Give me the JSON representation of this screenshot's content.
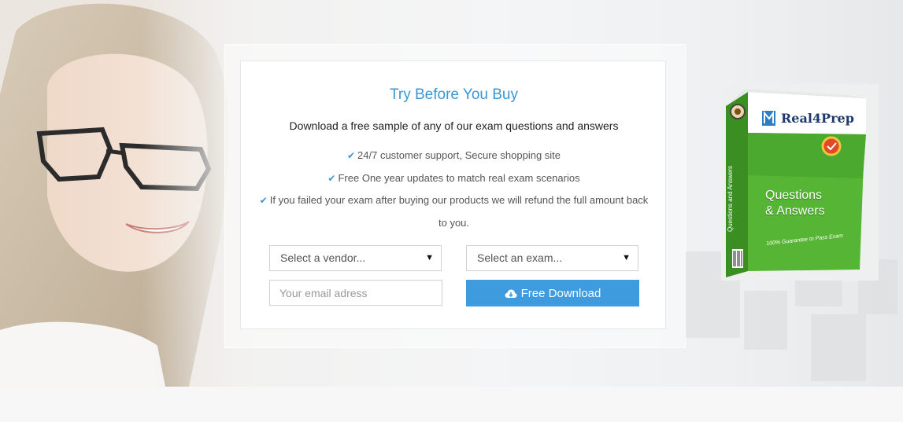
{
  "trial": {
    "title": "Try Before You Buy",
    "subtitle": "Download a free sample of any of our exam questions and answers",
    "features": [
      "24/7 customer support, Secure shopping site",
      "Free One year updates to match real exam scenarios",
      "If you failed your exam after buying our products we will refund the full amount back to you."
    ]
  },
  "form": {
    "vendor_select": "Select a vendor...",
    "exam_select": "Select an exam...",
    "email_placeholder": "Your email adress",
    "download_label": "Free Download"
  },
  "product_box": {
    "brand": "Real4Prep",
    "line1": "Questions",
    "line2": "& Answers",
    "guarantee": "100% Guarantee to Pass Exam",
    "side_text": "Questions and Answers"
  },
  "icons": {
    "feature_check": "check-icon",
    "download_cloud": "cloud-download-icon",
    "select_arrow": "caret-down-icon"
  },
  "colors": {
    "accent": "#3a97d4",
    "button": "#3d9bde",
    "box_green": "#4aa92e"
  }
}
